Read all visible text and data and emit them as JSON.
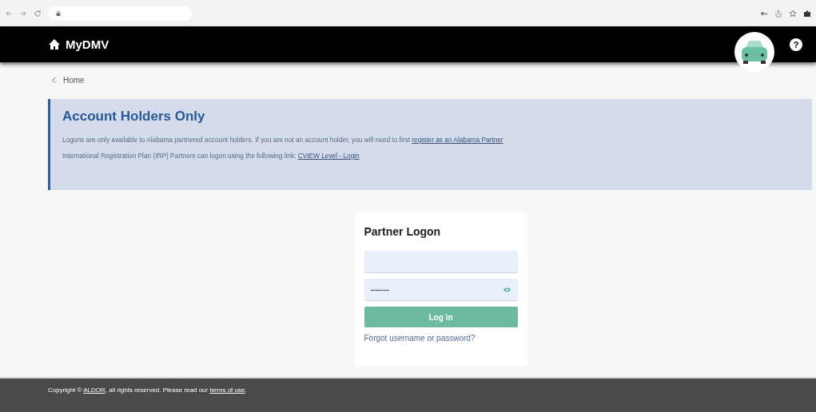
{
  "header": {
    "title": "MyDMV",
    "help": "?"
  },
  "breadcrumb": {
    "label": "Home"
  },
  "notice": {
    "title": "Account Holders Only",
    "paragraphs": [
      {
        "text": "Logons are only available to Alabama partnered account holders. If you are not an account holder, you will need to first ",
        "link": "register as an Alabama Partner"
      },
      {
        "text": "International Registration Plan (IRP) Partners can logon using the following link: ",
        "link": "CVIEW Level - Login"
      }
    ]
  },
  "login": {
    "title": "Partner Logon",
    "password": {
      "value": "-------"
    },
    "button": "Log in",
    "forgot": "Forgot username or password?"
  },
  "footer": {
    "before": "Copyright © ",
    "link1": "ALDOR",
    "middle": ", all rights reserved. Please read our ",
    "link2": "terms of use",
    "after": "."
  }
}
